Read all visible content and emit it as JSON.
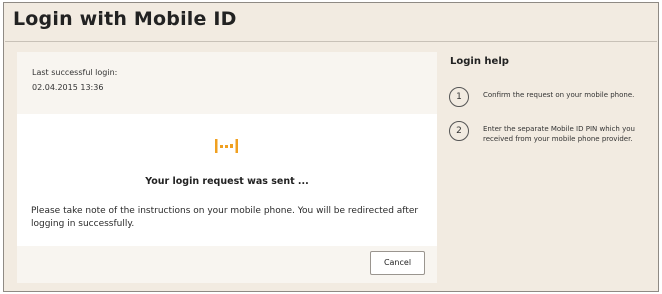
{
  "header": {
    "title": "Login with Mobile ID"
  },
  "login_panel": {
    "last_login_label": "Last successful login:",
    "last_login_value": "02.04.2015 13:36",
    "status_heading": "Your login request was sent ...",
    "instructions": "Please take note of the instructions on your mobile phone. You will be redirected after logging in successfully.",
    "cancel_label": "Cancel",
    "progress_icon": "loading-dots-icon",
    "accent_color": "#f0a020"
  },
  "help": {
    "title": "Login help",
    "steps": [
      {
        "number": "1",
        "text": "Confirm the request on your mobile phone."
      },
      {
        "number": "2",
        "text": "Enter the separate Mobile ID PIN which you received from your mobile phone provider."
      }
    ]
  }
}
